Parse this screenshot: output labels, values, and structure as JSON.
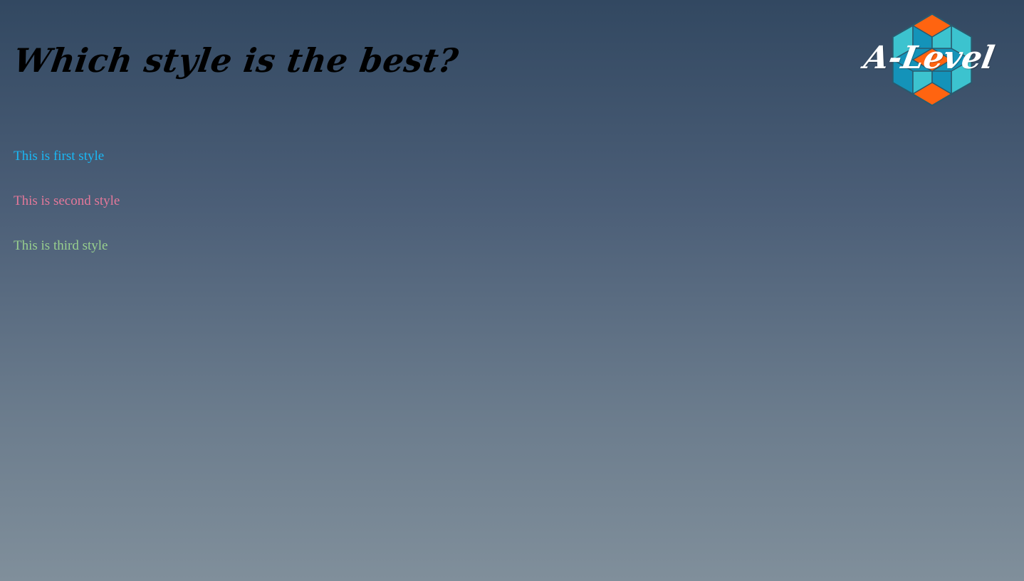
{
  "header": {
    "title": "Which style is the best?"
  },
  "logo": {
    "text": "A-Level",
    "icon": "hexagon-cube-logo-icon",
    "colors": {
      "orange": "#ff6410",
      "teal_light": "#3cc3cf",
      "teal_dark": "#1493b9",
      "outline": "#2a5a6e",
      "text": "#ffffff"
    }
  },
  "styles": [
    {
      "label": "This is first style",
      "color": "#1ab8f5"
    },
    {
      "label": "This is second style",
      "color": "#e5789a"
    },
    {
      "label": "This is third style",
      "color": "#98cf8e"
    }
  ]
}
